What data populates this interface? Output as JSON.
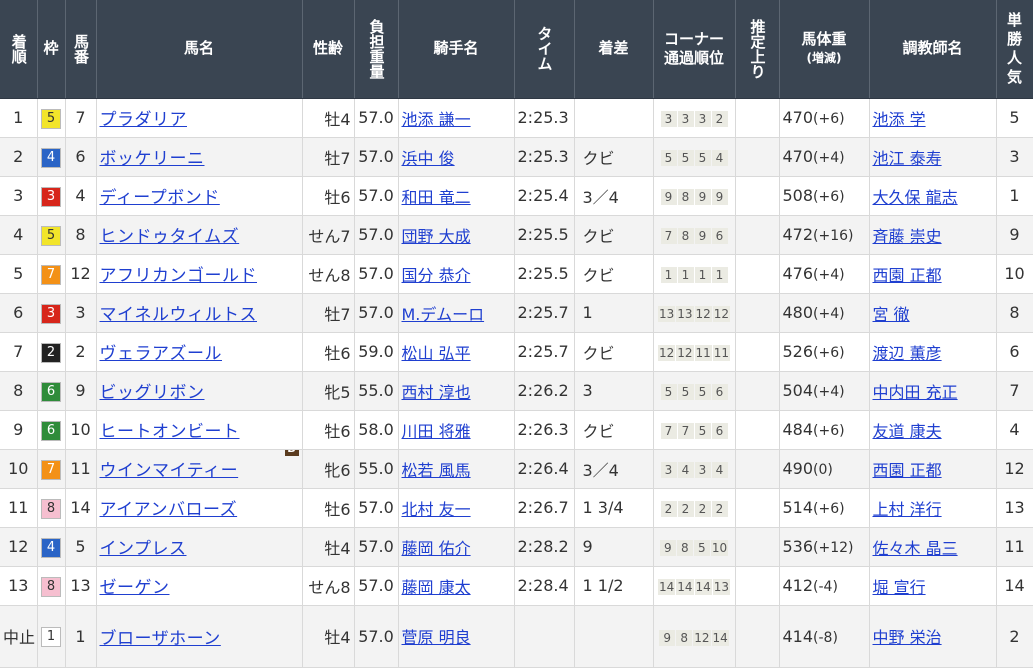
{
  "headers": {
    "rank": "着順",
    "waku": "枠",
    "uma": "馬番",
    "name": "馬名",
    "sexage": "性齢",
    "weight": "負担重量",
    "jockey": "騎手名",
    "time": "タイム",
    "margin": "着差",
    "corner": "コーナー通過順位",
    "last3f": "推定上り",
    "bodyweight": "馬体重",
    "bodyweight_sub": "(増減)",
    "trainer": "調教師名",
    "pop": "単勝人気"
  },
  "waku_colors": {
    "1": {
      "bg": "#ffffff",
      "fg": "#333333"
    },
    "2": {
      "bg": "#222222",
      "fg": "#ffffff"
    },
    "3": {
      "bg": "#d7261b",
      "fg": "#ffffff"
    },
    "4": {
      "bg": "#2a64c6",
      "fg": "#ffffff"
    },
    "5": {
      "bg": "#f2e52a",
      "fg": "#333333"
    },
    "6": {
      "bg": "#2f8c3a",
      "fg": "#ffffff"
    },
    "7": {
      "bg": "#f39117",
      "fg": "#ffffff"
    },
    "8": {
      "bg": "#f6bfd0",
      "fg": "#333333"
    }
  },
  "rows": [
    {
      "rank": "1",
      "waku": "5",
      "uma": "7",
      "name": "プラダリア",
      "blinker": "",
      "sexage": "牡4",
      "weight": "57.0",
      "jockey": "池添 謙一",
      "time": "2:25.3",
      "margin": "",
      "corner": [
        "3",
        "3",
        "3",
        "2"
      ],
      "last3f": "",
      "bw": "470",
      "bwdiff": "(+6)",
      "trainer": "池添 学",
      "pop": "5"
    },
    {
      "rank": "2",
      "waku": "4",
      "uma": "6",
      "name": "ボッケリーニ",
      "blinker": "",
      "sexage": "牡7",
      "weight": "57.0",
      "jockey": "浜中 俊",
      "time": "2:25.3",
      "margin": "クビ",
      "corner": [
        "5",
        "5",
        "5",
        "4"
      ],
      "last3f": "",
      "bw": "470",
      "bwdiff": "(+4)",
      "trainer": "池江 泰寿",
      "pop": "3"
    },
    {
      "rank": "3",
      "waku": "3",
      "uma": "4",
      "name": "ディープボンド",
      "blinker": "",
      "sexage": "牡6",
      "weight": "57.0",
      "jockey": "和田 竜二",
      "time": "2:25.4",
      "margin": "3／4",
      "corner": [
        "9",
        "8",
        "9",
        "9"
      ],
      "last3f": "",
      "bw": "508",
      "bwdiff": "(+6)",
      "trainer": "大久保 龍志",
      "pop": "1"
    },
    {
      "rank": "4",
      "waku": "5",
      "uma": "8",
      "name": "ヒンドゥタイムズ",
      "blinker": "",
      "sexage": "せん7",
      "weight": "57.0",
      "jockey": "団野 大成",
      "time": "2:25.5",
      "margin": "クビ",
      "corner": [
        "7",
        "8",
        "9",
        "6"
      ],
      "last3f": "",
      "bw": "472",
      "bwdiff": "(+16)",
      "trainer": "斉藤 崇史",
      "pop": "9"
    },
    {
      "rank": "5",
      "waku": "7",
      "uma": "12",
      "name": "アフリカンゴールド",
      "blinker": "",
      "sexage": "せん8",
      "weight": "57.0",
      "jockey": "国分 恭介",
      "time": "2:25.5",
      "margin": "クビ",
      "corner": [
        "1",
        "1",
        "1",
        "1"
      ],
      "last3f": "",
      "bw": "476",
      "bwdiff": "(+4)",
      "trainer": "西園 正都",
      "pop": "10"
    },
    {
      "rank": "6",
      "waku": "3",
      "uma": "3",
      "name": "マイネルウィルトス",
      "blinker": "",
      "sexage": "牡7",
      "weight": "57.0",
      "jockey": "M.デムーロ",
      "time": "2:25.7",
      "margin": "1",
      "corner": [
        "13",
        "13",
        "12",
        "12"
      ],
      "last3f": "",
      "bw": "480",
      "bwdiff": "(+4)",
      "trainer": "宮 徹",
      "pop": "8"
    },
    {
      "rank": "7",
      "waku": "2",
      "uma": "2",
      "name": "ヴェラアズール",
      "blinker": "",
      "sexage": "牡6",
      "weight": "59.0",
      "jockey": "松山 弘平",
      "time": "2:25.7",
      "margin": "クビ",
      "corner": [
        "12",
        "12",
        "11",
        "11"
      ],
      "last3f": "",
      "bw": "526",
      "bwdiff": "(+6)",
      "trainer": "渡辺 薫彦",
      "pop": "6"
    },
    {
      "rank": "8",
      "waku": "6",
      "uma": "9",
      "name": "ビッグリボン",
      "blinker": "",
      "sexage": "牝5",
      "weight": "55.0",
      "jockey": "西村 淳也",
      "time": "2:26.2",
      "margin": "3",
      "corner": [
        "5",
        "5",
        "5",
        "6"
      ],
      "last3f": "",
      "bw": "504",
      "bwdiff": "(+4)",
      "trainer": "中内田 充正",
      "pop": "7"
    },
    {
      "rank": "9",
      "waku": "6",
      "uma": "10",
      "name": "ヒートオンビート",
      "blinker": "",
      "sexage": "牡6",
      "weight": "58.0",
      "jockey": "川田 将雅",
      "time": "2:26.3",
      "margin": "クビ",
      "corner": [
        "7",
        "7",
        "5",
        "6"
      ],
      "last3f": "",
      "bw": "484",
      "bwdiff": "(+6)",
      "trainer": "友道 康夫",
      "pop": "4"
    },
    {
      "rank": "10",
      "waku": "7",
      "uma": "11",
      "name": "ウインマイティー",
      "blinker": "B",
      "sexage": "牝6",
      "weight": "55.0",
      "jockey": "松若 風馬",
      "time": "2:26.4",
      "margin": "3／4",
      "corner": [
        "3",
        "4",
        "3",
        "4"
      ],
      "last3f": "",
      "bw": "490",
      "bwdiff": "(0)",
      "trainer": "西園 正都",
      "pop": "12"
    },
    {
      "rank": "11",
      "waku": "8",
      "uma": "14",
      "name": "アイアンバローズ",
      "blinker": "",
      "sexage": "牡6",
      "weight": "57.0",
      "jockey": "北村 友一",
      "time": "2:26.7",
      "margin": "1 3/4",
      "corner": [
        "2",
        "2",
        "2",
        "2"
      ],
      "last3f": "",
      "bw": "514",
      "bwdiff": "(+6)",
      "trainer": "上村 洋行",
      "pop": "13"
    },
    {
      "rank": "12",
      "waku": "4",
      "uma": "5",
      "name": "インプレス",
      "blinker": "",
      "sexage": "牡4",
      "weight": "57.0",
      "jockey": "藤岡 佑介",
      "time": "2:28.2",
      "margin": "9",
      "corner": [
        "9",
        "8",
        "5",
        "10"
      ],
      "last3f": "",
      "bw": "536",
      "bwdiff": "(+12)",
      "trainer": "佐々木 晶三",
      "pop": "11"
    },
    {
      "rank": "13",
      "waku": "8",
      "uma": "13",
      "name": "ゼーゲン",
      "blinker": "",
      "sexage": "せん8",
      "weight": "57.0",
      "jockey": "藤岡 康太",
      "time": "2:28.4",
      "margin": "1 1/2",
      "corner": [
        "14",
        "14",
        "14",
        "13"
      ],
      "last3f": "",
      "bw": "412",
      "bwdiff": "(-4)",
      "trainer": "堀 宣行",
      "pop": "14"
    },
    {
      "rank": "中止",
      "waku": "1",
      "uma": "1",
      "name": "ブローザホーン",
      "blinker": "",
      "sexage": "牡4",
      "weight": "57.0",
      "jockey": "菅原 明良",
      "time": "",
      "margin": "",
      "corner": [
        "9",
        "8",
        "12",
        "14"
      ],
      "last3f": "",
      "bw": "414",
      "bwdiff": "(-8)",
      "trainer": "中野 栄治",
      "pop": "2"
    }
  ]
}
